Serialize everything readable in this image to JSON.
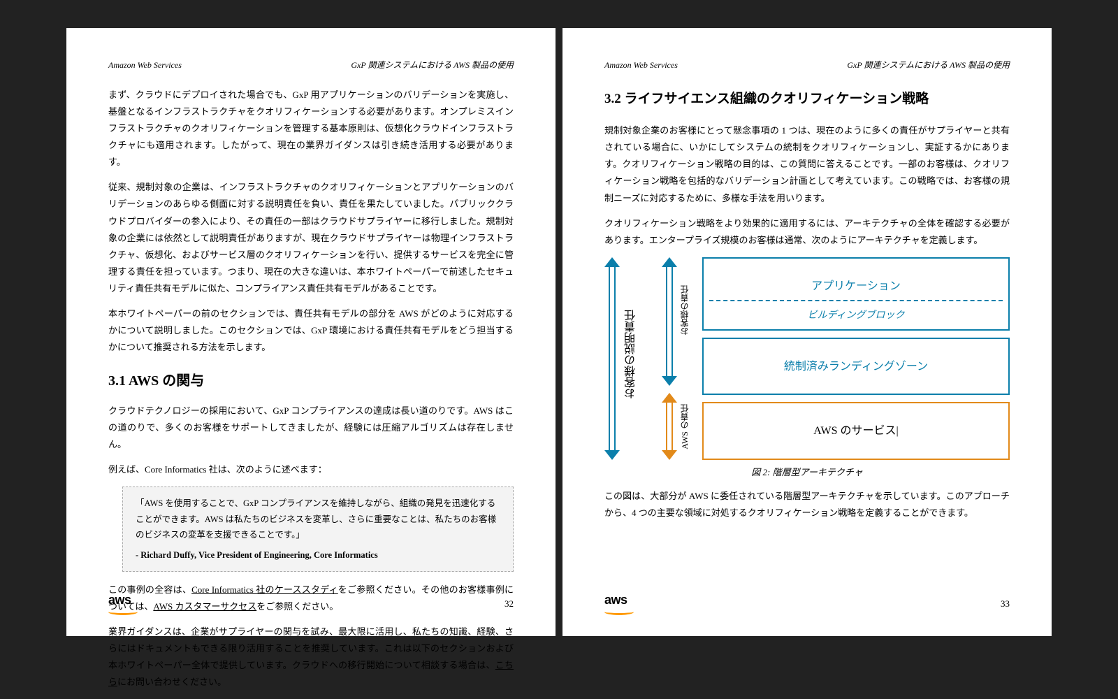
{
  "header": {
    "left": "Amazon Web Services",
    "right": "GxP 関連システムにおける AWS 製品の使用"
  },
  "left": {
    "p1": "まず、クラウドにデプロイされた場合でも、GxP 用アプリケーションのバリデーションを実施し、基盤となるインフラストラクチャをクオリフィケーションする必要があります。オンプレミスインフラストラクチャのクオリフィケーションを管理する基本原則は、仮想化クラウドインフラストラクチャにも適用されます。したがって、現在の業界ガイダンスは引き続き活用する必要があります。",
    "p2": "従来、規制対象の企業は、インフラストラクチャのクオリフィケーションとアプリケーションのバリデーションのあらゆる側面に対する説明責任を負い、責任を果たしていました。パブリッククラウドプロバイダーの参入により、その責任の一部はクラウドサプライヤーに移行しました。規制対象の企業には依然として説明責任がありますが、現在クラウドサプライヤーは物理インフラストラクチャ、仮想化、およびサービス層のクオリフィケーションを行い、提供するサービスを完全に管理する責任を担っています。つまり、現在の大きな違いは、本ホワイトペーパーで前述したセキュリティ責任共有モデルに似た、コンプライアンス責任共有モデルがあることです。",
    "p3": "本ホワイトペーパーの前のセクションでは、責任共有モデルの部分を AWS がどのように対応するかについて説明しました。このセクションでは、GxP 環境における責任共有モデルをどう担当するかについて推奨される方法を示します。",
    "h31": "3.1 AWS の関与",
    "p4": "クラウドテクノロジーの採用において、GxP コンプライアンスの達成は長い道のりです。AWS はこの道のりで、多くのお客様をサポートしてきましたが、経験には圧縮アルゴリズムは存在しません。",
    "p5": "例えば、Core Informatics 社は、次のように述べます：",
    "quote": "「AWS を使用することで、GxP コンプライアンスを維持しながら、組織の発見を迅速化することができます。AWS は私たちのビジネスを変革し、さらに重要なことは、私たちのお客様のビジネスの変革を支援できることです。」",
    "quoteWho": "- Richard Duffy, Vice President of Engineering, Core Informatics",
    "p6a": "この事例の全容は、",
    "p6link1": "Core Informatics 社のケーススタディ",
    "p6b": "をご参照ください。その他のお客様事例については、",
    "p6link2": "AWS カスタマーサクセス",
    "p6c": "をご参照ください。",
    "p7a": "業界ガイダンスは、企業がサプライヤーの関与を試み、最大限に活用し、私たちの知識、経験、さらにはドキュメントもできる限り活用することを推奨しています。これは以下のセクションおよび本ホワイトペーパー全体で提供しています。クラウドへの移行開始について相談する場合は、",
    "p7link": "こちら",
    "p7b": "にお問い合わせください。",
    "pageNo": "32"
  },
  "right": {
    "h32": "3.2 ライフサイエンス組織のクオリフィケーション戦略",
    "p1": "規制対象企業のお客様にとって懸念事項の 1 つは、現在のように多くの責任がサプライヤーと共有されている場合に、いかにしてシステムの統制をクオリフィケーションし、実証するかにあります。クオリフィケーション戦略の目的は、この質問に答えることです。一部のお客様は、クオリフィケーション戦略を包括的なバリデーション計画として考えています。この戦略では、お客様の規制ニーズに対応するために、多様な手法を用いります。",
    "p2": "クオリフィケーション戦略をより効果的に適用するには、アーキテクチャの全体を確認する必要があります。エンタープライズ規模のお客様は通常、次のようにアーキテクチャを定義します。",
    "diag": {
      "a1": "お客様の説明責任",
      "a2": "お客様の責任",
      "a3": "AWS の責任",
      "box1": "アプリケーション",
      "box1sub": "ビルディングブロック",
      "box2": "統制済みランディングゾーン",
      "box3": "AWS のサービス|",
      "blue": "#0b7fab",
      "orange": "#e28a1a"
    },
    "figcap": "図 2: 階層型アーキテクチャ",
    "p3": "この図は、大部分が AWS に委任されている階層型アーキテクチャを示しています。このアプローチから、4 つの主要な領域に対処するクオリフィケーション戦略を定義することができます。",
    "pageNo": "33"
  },
  "logo": "aws"
}
